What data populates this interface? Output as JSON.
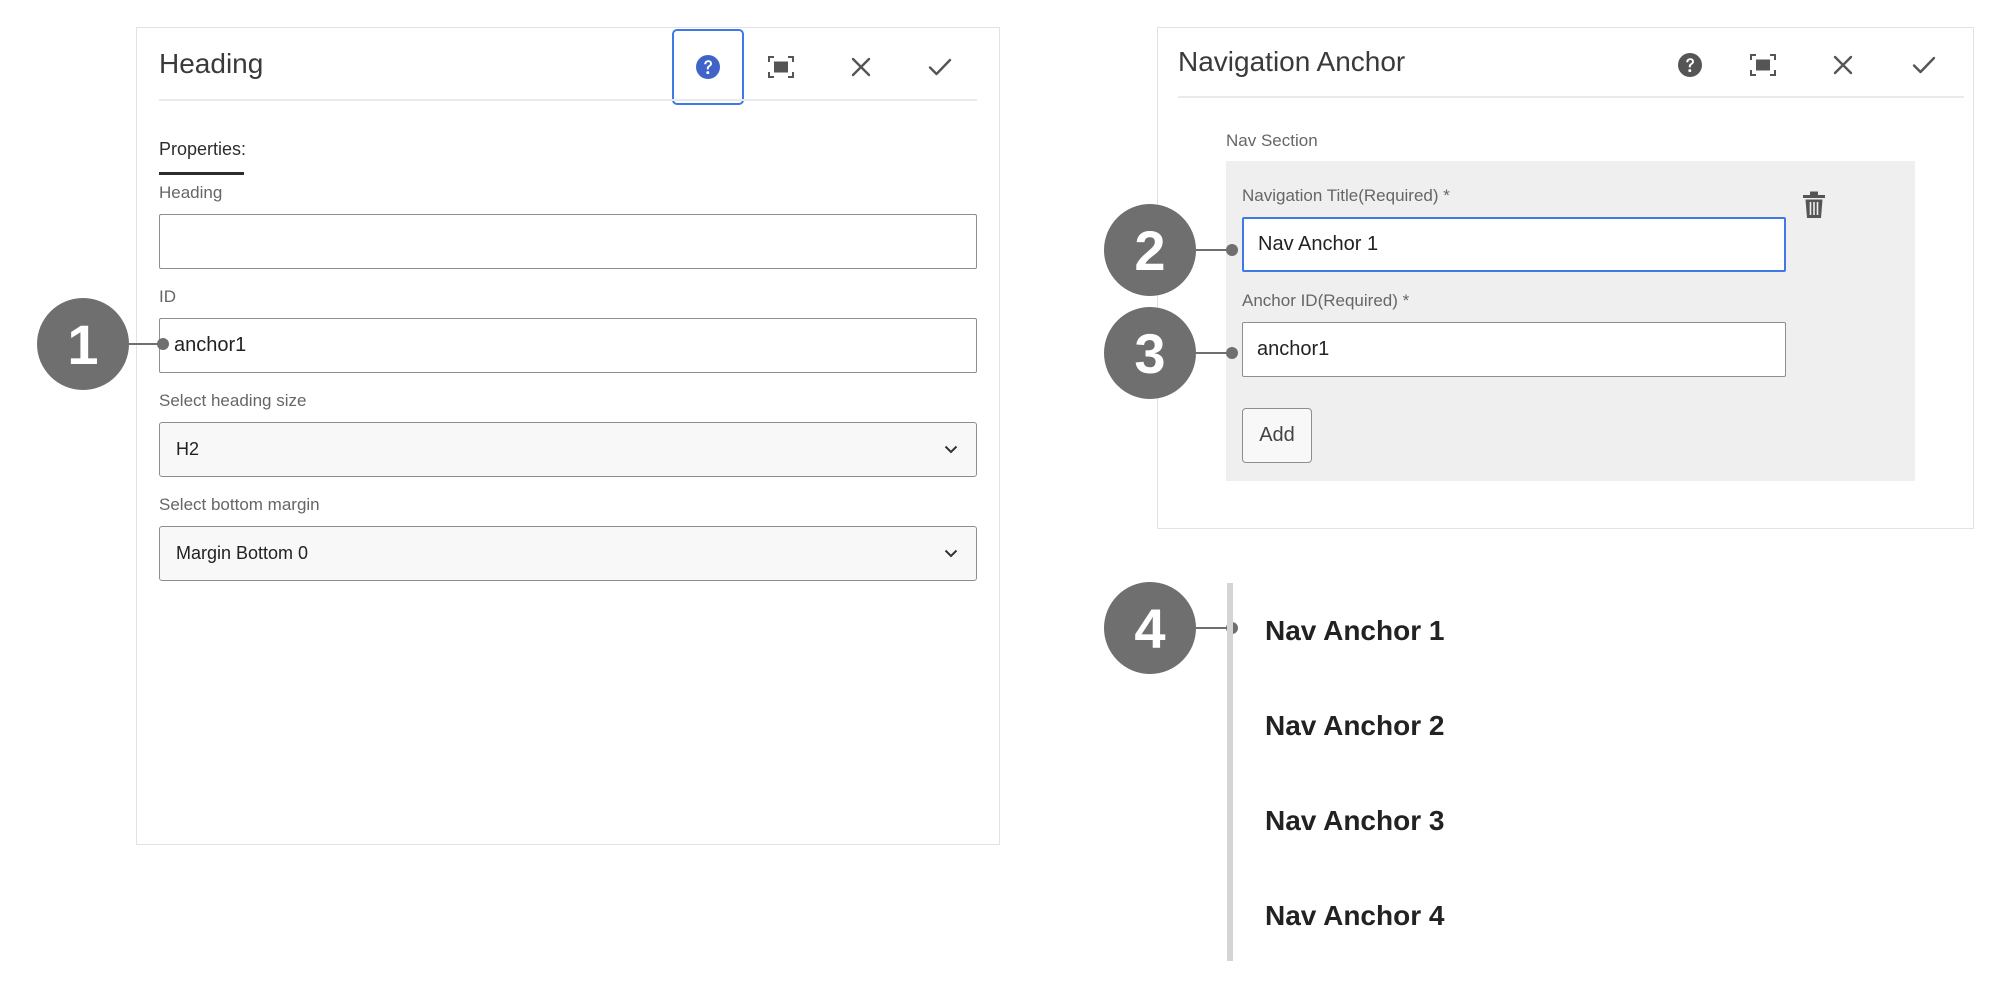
{
  "heading_dialog": {
    "title": "Heading",
    "tab": "Properties:",
    "heading_label": "Heading",
    "heading_value": "",
    "id_label": "ID",
    "id_value": "anchor1",
    "size_label": "Select heading size",
    "size_value": "H2",
    "margin_label": "Select bottom margin",
    "margin_value": "Margin Bottom 0",
    "focused_tool": "help-icon"
  },
  "nav_dialog": {
    "title": "Navigation Anchor",
    "section_label": "Nav Section",
    "title_label": "Navigation Title(Required) *",
    "title_value": "Nav Anchor 1",
    "anchor_label": "Anchor ID(Required) *",
    "anchor_value": "anchor1",
    "add_label": "Add"
  },
  "toolbar_icons": [
    "help-icon",
    "fullscreen-icon",
    "close-icon",
    "checkmark-icon"
  ],
  "callouts": [
    "1",
    "2",
    "3",
    "4"
  ],
  "nav_list": [
    "Nav Anchor 1",
    "Nav Anchor 2",
    "Nav Anchor 3",
    "Nav Anchor 4"
  ],
  "colors": {
    "accent": "#3f79e6",
    "callout": "#6f6f6f",
    "help_icon_active": "#3f63c8"
  }
}
